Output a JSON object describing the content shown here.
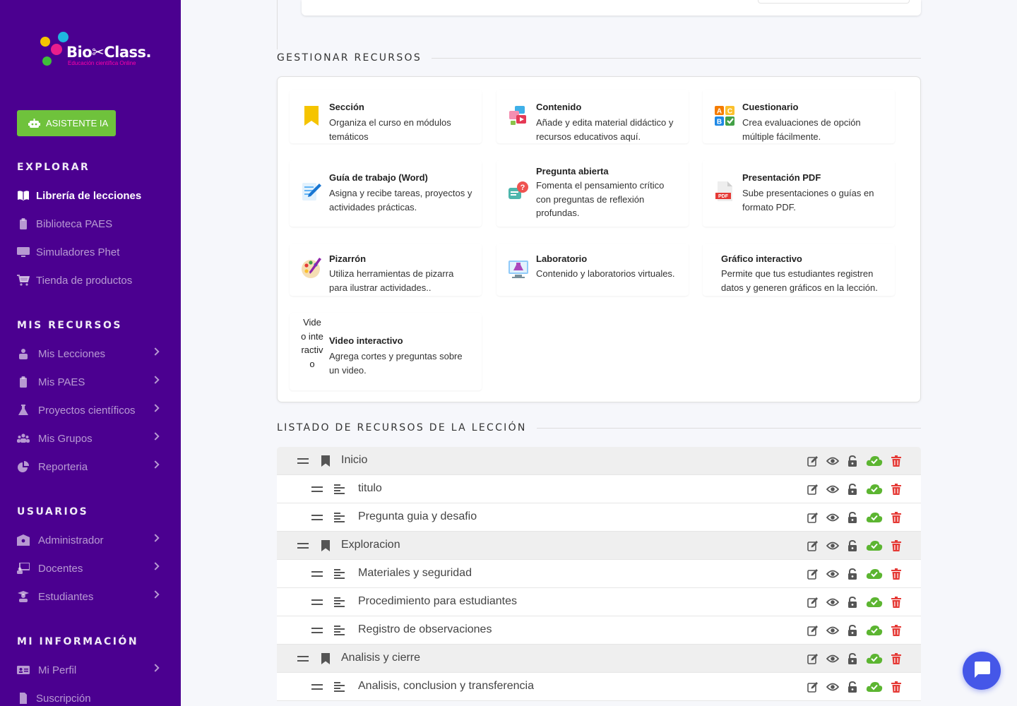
{
  "brand": {
    "name": "Bio✂Class.",
    "tagline": "Educación científica Online"
  },
  "sidebar": {
    "ai_button": "ASISTENTE IA",
    "sections": {
      "explorar": "EXPLORAR",
      "mis_recursos": "MIS RECURSOS",
      "usuarios": "USUARIOS",
      "mi_informacion": "MI INFORMACIÓN"
    },
    "explorar": [
      "Librería de lecciones",
      "Biblioteca PAES",
      "Simuladores Phet",
      "Tienda de productos"
    ],
    "mis_recursos": [
      "Mis Lecciones",
      "Mis PAES",
      "Proyectos científicos",
      "Mis Grupos",
      "Reporteria"
    ],
    "usuarios": [
      "Administrador",
      "Docentes",
      "Estudiantes"
    ],
    "mi_informacion": [
      "Mi Perfil",
      "Suscripción"
    ]
  },
  "main": {
    "gestionar_title": "GESTIONAR RECURSOS",
    "listado_title": "LISTADO DE RECURSOS DE LA LECCIÓN",
    "resources": [
      {
        "title": "Sección",
        "desc": "Organiza el curso en módulos temáticos",
        "icon": "bookmark-icon"
      },
      {
        "title": "Contenido",
        "desc": "Añade y edita material didáctico y recursos educativos aquí.",
        "icon": "media-content-icon"
      },
      {
        "title": "Cuestionario",
        "desc": "Crea evaluaciones de opción múltiple fácilmente.",
        "icon": "abc-quiz-icon"
      },
      {
        "title": "Guía de trabajo (Word)",
        "desc": "Asigna y recibe tareas, proyectos y actividades prácticas.",
        "icon": "document-pen-icon"
      },
      {
        "title": "Pregunta abierta",
        "desc": "Fomenta el pensamiento crítico con preguntas de reflexión profundas.",
        "icon": "question-chat-icon"
      },
      {
        "title": "Presentación PDF",
        "desc": "Sube presentaciones o guías en formato PDF.",
        "icon": "pdf-file-icon"
      },
      {
        "title": "Pizarrón",
        "desc": "Utiliza herramientas de pizarra para ilustrar actividades..",
        "icon": "palette-brush-icon"
      },
      {
        "title": "Laboratorio",
        "desc": "Contenido y laboratorios virtuales.",
        "icon": "lab-flask-icon"
      },
      {
        "title": "Gráfico interactivo",
        "desc": "Permite que tus estudiantes registren datos y generen gráficos en la lección.",
        "icon": ""
      },
      {
        "title": "Video interactivo",
        "desc": "Agrega cortes y preguntas sobre un video.",
        "icon": "broken-image-icon",
        "alt": "Video interactivo"
      }
    ],
    "rows": [
      {
        "label": "Inicio",
        "type": "section"
      },
      {
        "label": "titulo",
        "type": "item"
      },
      {
        "label": "Pregunta guia y desafio",
        "type": "item"
      },
      {
        "label": "Exploracion",
        "type": "section"
      },
      {
        "label": "Materiales y seguridad",
        "type": "item"
      },
      {
        "label": "Procedimiento para estudiantes",
        "type": "item"
      },
      {
        "label": "Registro de observaciones",
        "type": "item"
      },
      {
        "label": "Analisis y cierre",
        "type": "section"
      },
      {
        "label": "Analisis, conclusion y transferencia",
        "type": "item"
      }
    ]
  },
  "colors": {
    "sidebar": "#4b0090",
    "ai_button": "#6fc23c",
    "cloud": "#5cb531",
    "delete": "#e53935",
    "chat": "#4557e8"
  }
}
